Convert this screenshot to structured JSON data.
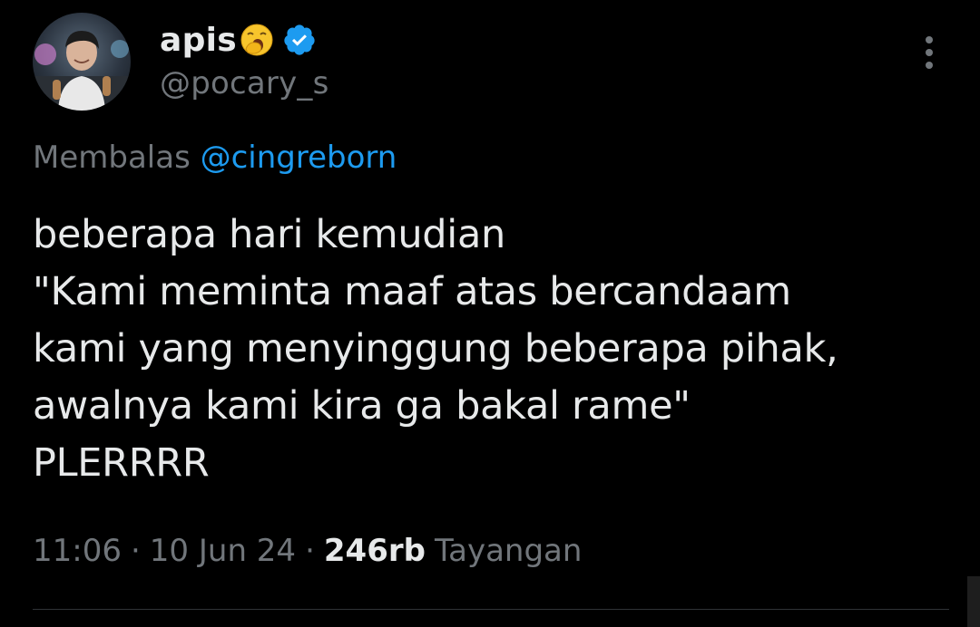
{
  "tweet": {
    "author": {
      "display_name": "apis",
      "emoji": "yawning-face",
      "verified": true,
      "handle": "@pocary_s",
      "avatar": "user-photo"
    },
    "reply": {
      "prefix": "Membalas",
      "mention": "@cingreborn"
    },
    "text_lines": [
      "beberapa hari kemudian",
      "\"Kami meminta maaf atas bercandaam",
      "kami yang menyinggung beberapa pihak,",
      "awalnya kami kira ga bakal rame\"",
      "PLERRRR"
    ],
    "meta": {
      "time": "11:06",
      "separator": "·",
      "date": "10 Jun 24",
      "views_count": "246rb",
      "views_label": "Tayangan"
    },
    "more_icon": "more-vertical-icon"
  },
  "colors": {
    "background": "#000000",
    "text_primary": "#e7e9ea",
    "text_secondary": "#71767b",
    "accent": "#1d9bf0",
    "divider": "#2f3336"
  }
}
